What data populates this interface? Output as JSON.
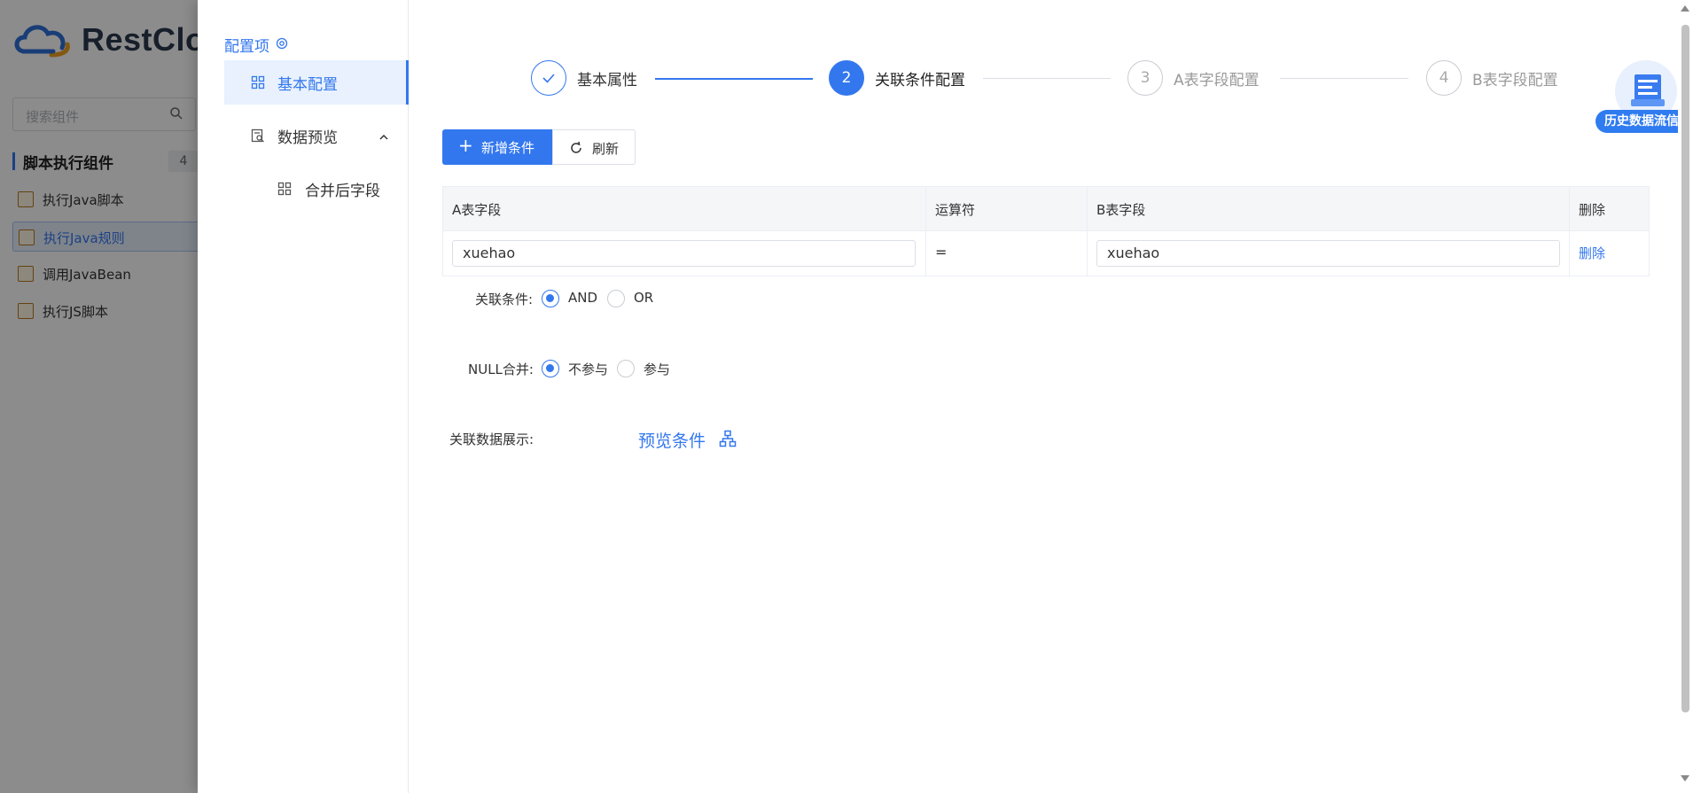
{
  "background_app": {
    "logo_text": "RestClo",
    "search_placeholder": "搜索组件",
    "group_title": "脚本执行组件",
    "group_count": "4",
    "items": [
      {
        "label": "执行Java脚本",
        "icon": "java-script-icon"
      },
      {
        "label": "执行Java规则",
        "icon": "java-rule-icon",
        "active": true
      },
      {
        "label": "调用JavaBean",
        "icon": "java-bean-icon"
      },
      {
        "label": "执行JS脚本",
        "icon": "js-script-icon"
      }
    ]
  },
  "config_nav": {
    "title": "配置项",
    "items": [
      {
        "label": "基本配置",
        "icon": "grid-icon",
        "active": true
      },
      {
        "label": "数据预览",
        "icon": "preview-icon",
        "expanded": true
      },
      {
        "label": "合并后字段",
        "icon": "grid-icon"
      }
    ]
  },
  "stepper": {
    "steps": [
      {
        "number": "1",
        "label": "基本属性",
        "status": "done"
      },
      {
        "number": "2",
        "label": "关联条件配置",
        "status": "active"
      },
      {
        "number": "3",
        "label": "A表字段配置",
        "status": "wait"
      },
      {
        "number": "4",
        "label": "B表字段配置",
        "status": "wait"
      }
    ]
  },
  "history_badge": {
    "label": "历史数据流信息"
  },
  "toolbar": {
    "add_label": "新增条件",
    "refresh_label": "刷新"
  },
  "table": {
    "columns": [
      "A表字段",
      "运算符",
      "B表字段",
      "删除"
    ],
    "rows": [
      {
        "a_field": "xuehao",
        "operator": "=",
        "b_field": "xuehao",
        "action": "删除"
      }
    ]
  },
  "join_condition": {
    "label": "关联条件:",
    "options": [
      "AND",
      "OR"
    ],
    "selected": "AND"
  },
  "null_merge": {
    "label": "NULL合并:",
    "options": [
      "不参与",
      "参与"
    ],
    "selected": "不参与"
  },
  "join_display": {
    "label": "关联数据展示:",
    "link_label": "预览条件"
  },
  "colors": {
    "accent": "#3377ee",
    "overlay": "rgba(0,0,0,0.45)"
  }
}
